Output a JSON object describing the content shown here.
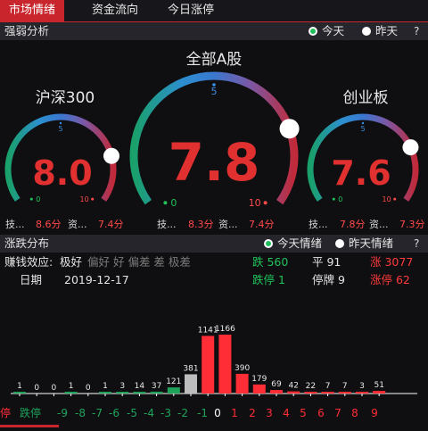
{
  "tabs": [
    {
      "label": "市场情绪",
      "active": true
    },
    {
      "label": "资金流向",
      "active": false
    },
    {
      "label": "今日涨停",
      "active": false
    }
  ],
  "strength": {
    "title": "强弱分析",
    "opt_today": "今天",
    "opt_yesterday": "昨天",
    "help": "?",
    "gauges": [
      {
        "name": "沪深300",
        "value": "8.0",
        "level": 8.0,
        "scale_min": "0",
        "scale_mid": "5",
        "scale_max": "10",
        "tech_label": "技...",
        "tech_value": "8.6分",
        "fund_label": "资...",
        "fund_value": "7.4分"
      },
      {
        "name": "全部A股",
        "value": "7.8",
        "level": 7.8,
        "scale_min": "0",
        "scale_mid": "5",
        "scale_max": "10",
        "tech_label": "技...",
        "tech_value": "8.3分",
        "fund_label": "资...",
        "fund_value": "7.4分"
      },
      {
        "name": "创业板",
        "value": "7.6",
        "level": 7.6,
        "scale_min": "0",
        "scale_mid": "5",
        "scale_max": "10",
        "tech_label": "技...",
        "tech_value": "7.8分",
        "fund_label": "资...",
        "fund_value": "7.3分"
      }
    ]
  },
  "distribution": {
    "title": "涨跌分布",
    "opt_today": "今天情绪",
    "opt_yesterday": "昨天情绪",
    "help": "?",
    "effect_label": "赚钱效应:",
    "effect_current": "极好",
    "effect_others": "偏好 好 偏差 差 极差",
    "date_label": "日期",
    "date_value": "2019-12-17",
    "down_label": "跌 560",
    "flat_label": "平 91",
    "up_label": "涨 3077",
    "limit_down_label": "跌停 1",
    "suspended_label": "停牌 9",
    "limit_up_label": "涨停 62"
  },
  "chart_data": {
    "type": "bar",
    "categories": [
      "跌停",
      "-9",
      "-8",
      "-7",
      "-6",
      "-5",
      "-4",
      "-3",
      "-2",
      "-1",
      "0",
      "1",
      "2",
      "3",
      "4",
      "5",
      "6",
      "7",
      "8",
      "9",
      "涨停"
    ],
    "values": [
      1,
      0,
      0,
      1,
      0,
      1,
      3,
      14,
      37,
      121,
      381,
      1141,
      1166,
      390,
      179,
      69,
      42,
      22,
      7,
      7,
      3,
      51
    ],
    "count_labels": [
      "1",
      "0",
      "0",
      "1",
      "0",
      "1",
      "3",
      "14",
      "37",
      "121",
      "381",
      "1141",
      "1166",
      "390",
      "179",
      "69",
      "42",
      "22",
      "7",
      "7",
      "3",
      "51"
    ],
    "colors": {
      "down": "#1fa35a",
      "flat": "#bdbdbd",
      "up": "#ff2d36"
    }
  }
}
